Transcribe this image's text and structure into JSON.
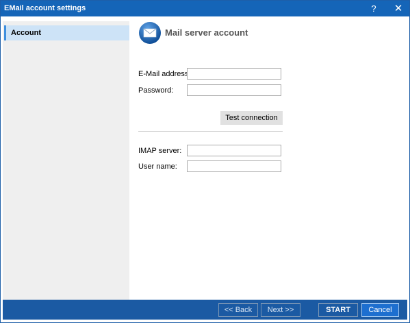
{
  "window": {
    "title": "EMail account settings",
    "help": "?",
    "close": "✕"
  },
  "sidebar": {
    "items": [
      {
        "label": "Account"
      }
    ]
  },
  "content": {
    "heading": "Mail server account",
    "email_label": "E-Mail address:",
    "email_value": "",
    "password_label": "Password:",
    "password_value": "",
    "test_button": "Test connection",
    "imap_label": "IMAP server:",
    "imap_value": "",
    "username_label": "User name:",
    "username_value": ""
  },
  "footer": {
    "back": "<< Back",
    "next": "Next >>",
    "start": "START",
    "cancel": "Cancel"
  },
  "colors": {
    "titlebar": "#1565b8",
    "footer": "#1b5aa3",
    "selection": "#cde3f7",
    "accent": "#3f8fde"
  },
  "icons": {
    "heading_icon": "envelope-icon"
  }
}
